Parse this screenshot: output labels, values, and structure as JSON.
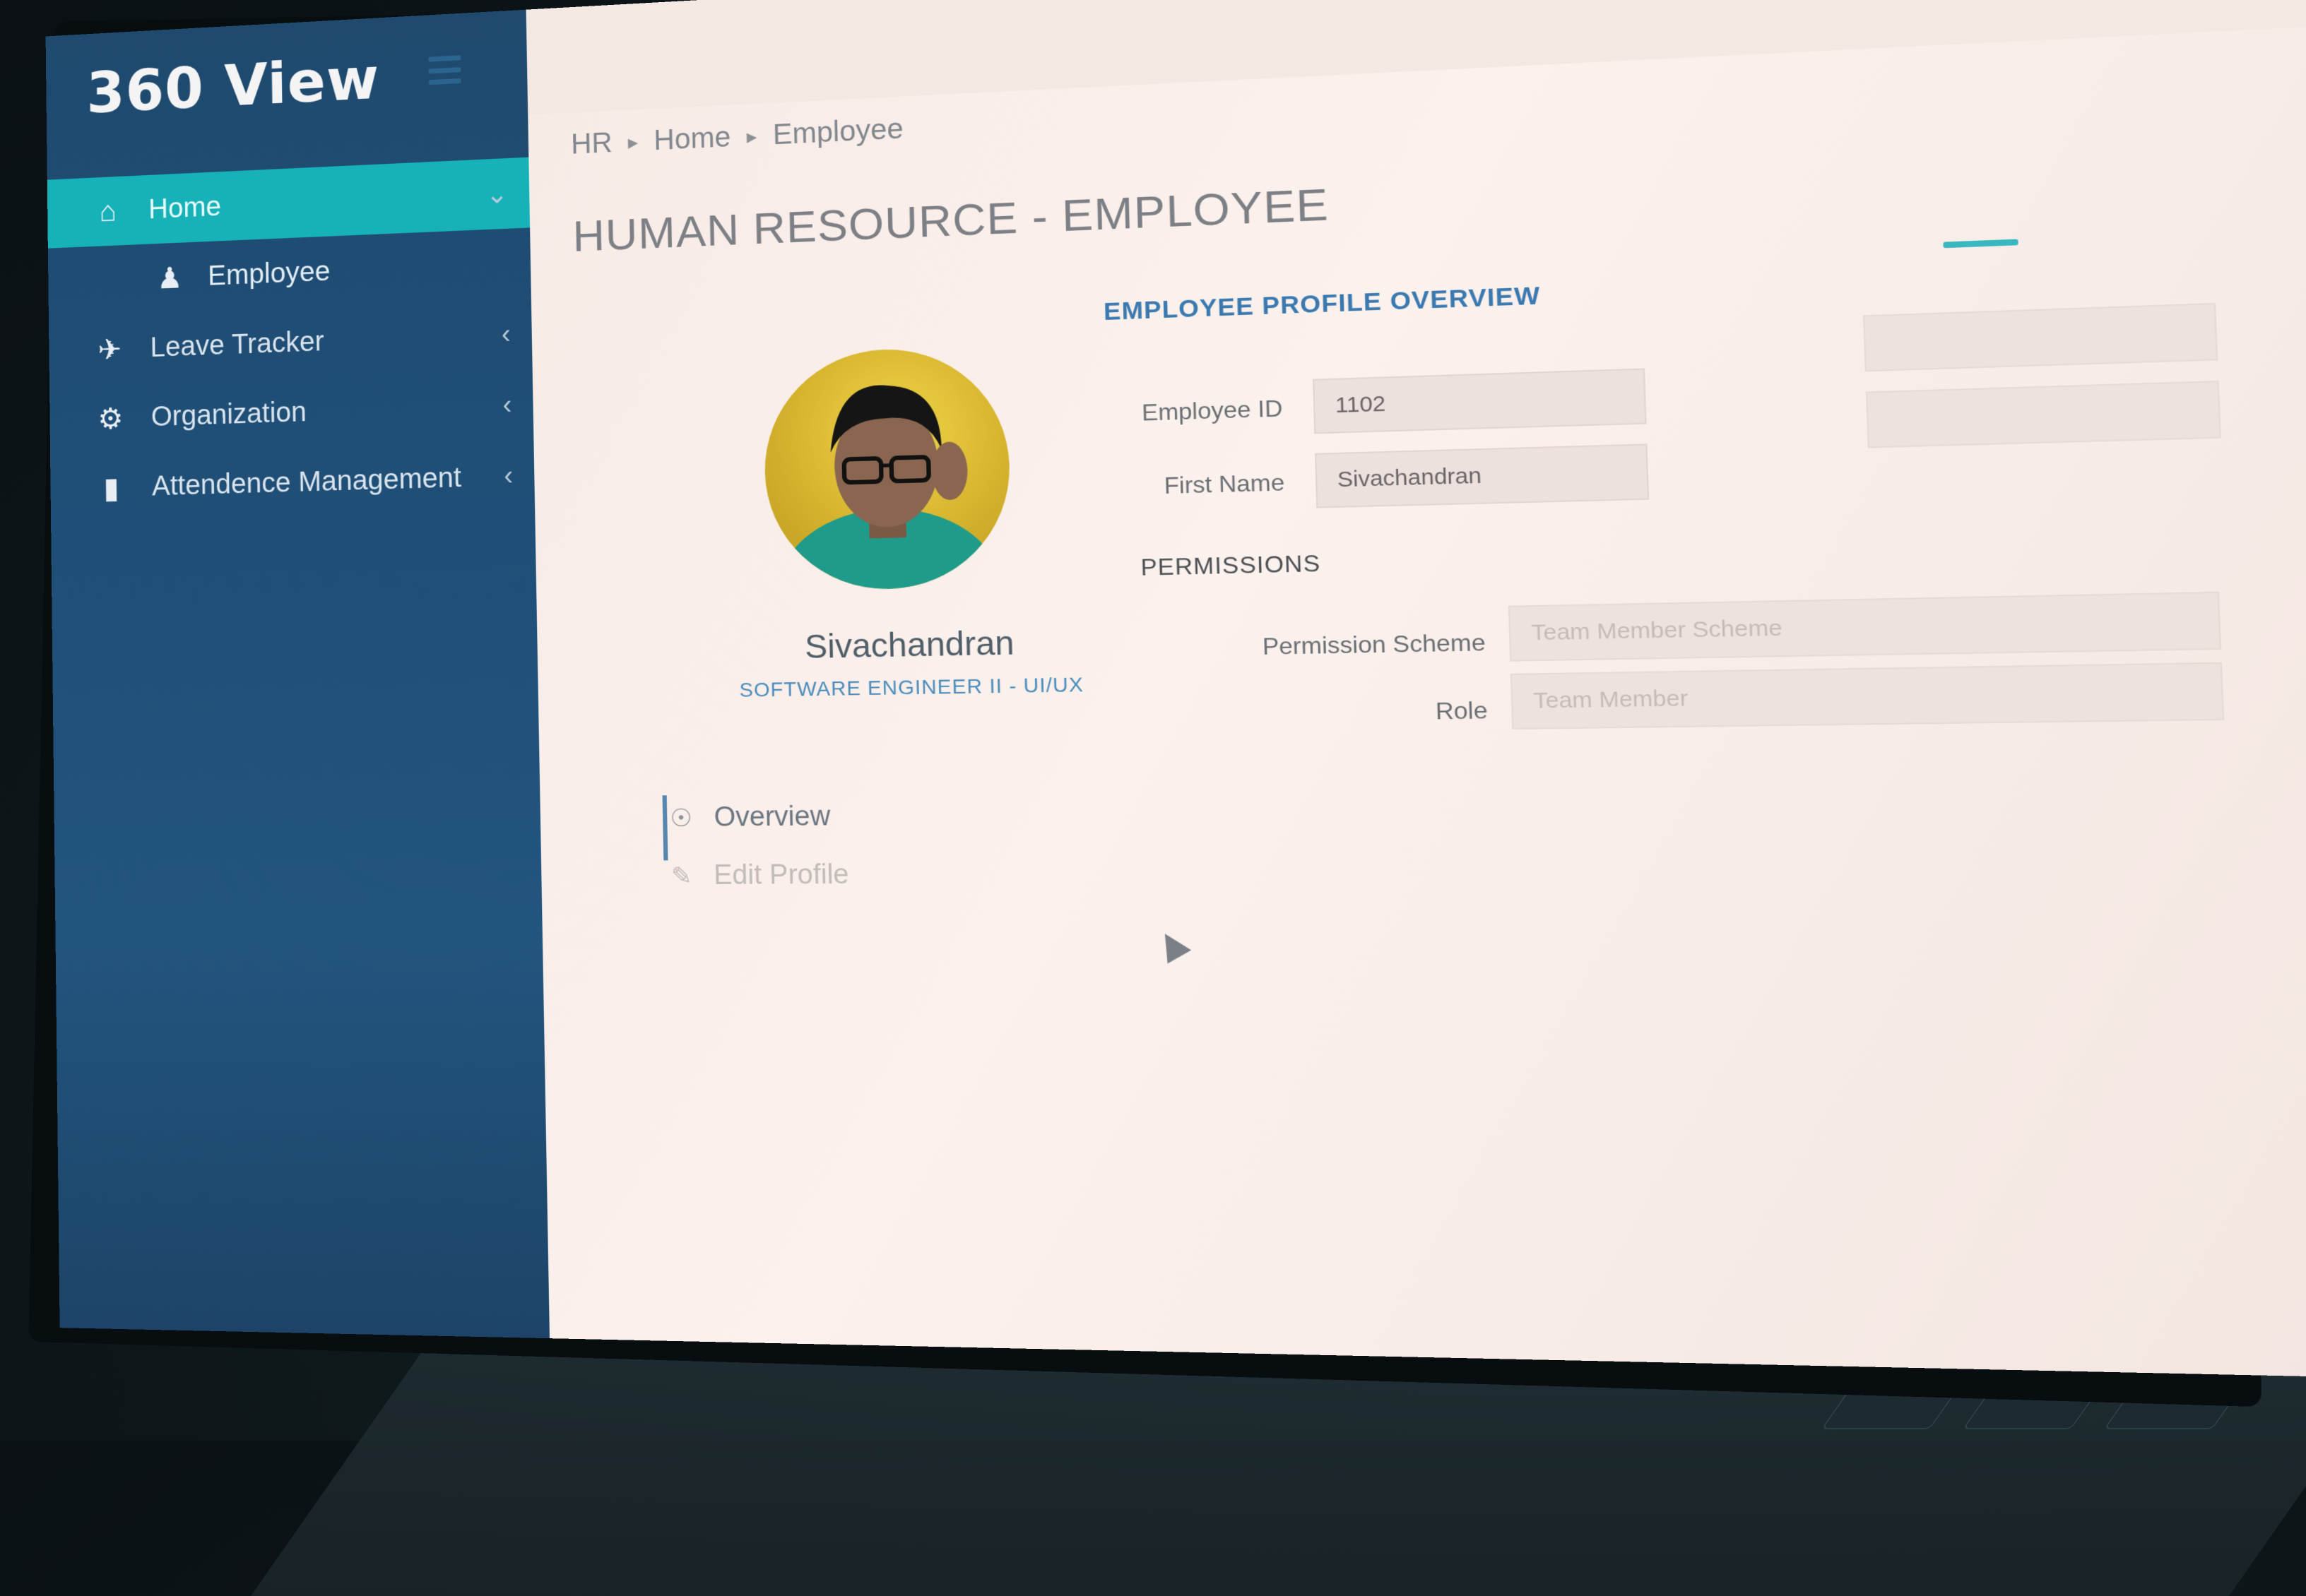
{
  "app": {
    "brand": "360 View"
  },
  "header": {
    "date": ""
  },
  "sidebar": {
    "items": [
      {
        "label": "Home",
        "icon": "home-icon",
        "active": true
      },
      {
        "label": "Employee",
        "icon": "user-icon",
        "sub": true
      },
      {
        "label": "Leave Tracker",
        "icon": "plane-icon"
      },
      {
        "label": "Organization",
        "icon": "users-icon"
      },
      {
        "label": "Attendence Management",
        "icon": "file-icon"
      }
    ],
    "footer": ""
  },
  "breadcrumb": [
    "HR",
    "Home",
    "Employee"
  ],
  "page": {
    "title": "HUMAN RESOURCE - EMPLOYEE",
    "tabs": [
      "",
      "",
      ""
    ]
  },
  "profile": {
    "name": "Sivachandran",
    "role": "SOFTWARE ENGINEER II - UI/UX",
    "menu": [
      {
        "label": "Overview",
        "icon": "eye-icon",
        "active": true
      },
      {
        "label": "Edit Profile",
        "icon": "pencil-icon",
        "active": false
      }
    ]
  },
  "overview": {
    "title": "EMPLOYEE PROFILE OVERVIEW",
    "employee_id_label": "Employee ID",
    "employee_id": "1102",
    "first_name_label": "First Name",
    "first_name": "Sivachandran",
    "email_label": "",
    "email": "",
    "last_name_label": "",
    "last_name": ""
  },
  "permissions": {
    "title": "PERMISSIONS",
    "scheme_label": "Permission Scheme",
    "scheme_value": "Team Member Scheme",
    "role_label": "Role",
    "role_value": "Team Member"
  },
  "colors": {
    "sidebar": "#1f4f78",
    "active": "#16b2b8",
    "accent_text": "#3a79b0",
    "content_bg": "#f7ebe6"
  }
}
